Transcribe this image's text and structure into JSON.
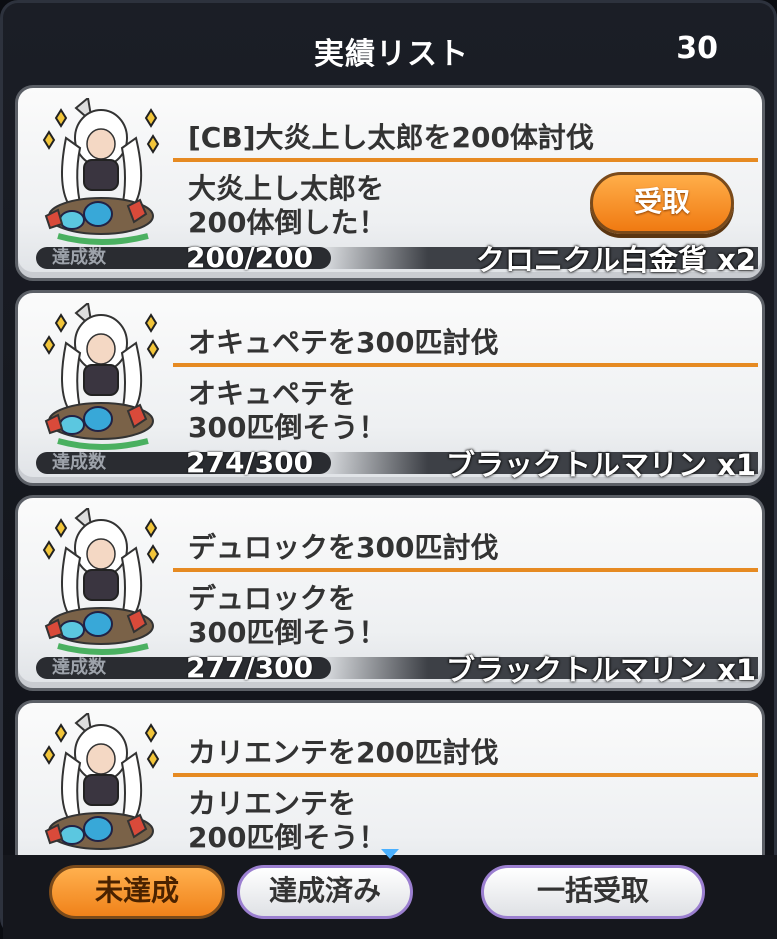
{
  "header": {
    "title": "実績リスト",
    "count": "30"
  },
  "achievements": [
    {
      "title": "[CB]大炎上し太郎を200体討伐",
      "desc_line1": "大炎上し太郎を",
      "desc_line2": "200体倒した！",
      "progress_label": "達成数",
      "progress": "200/200",
      "reward": "クロニクル白金貨 x2",
      "claim_label": "受取",
      "claimable": true
    },
    {
      "title": "オキュペテを300匹討伐",
      "desc_line1": "オキュペテを",
      "desc_line2": "300匹倒そう！",
      "progress_label": "達成数",
      "progress": "274/300",
      "reward": "ブラックトルマリン x1",
      "claimable": false
    },
    {
      "title": "デュロックを300匹討伐",
      "desc_line1": "デュロックを",
      "desc_line2": "300匹倒そう！",
      "progress_label": "達成数",
      "progress": "277/300",
      "reward": "ブラックトルマリン x1",
      "claimable": false
    },
    {
      "title": "カリエンテを200匹討伐",
      "desc_line1": "カリエンテを",
      "desc_line2": "200匹倒そう！",
      "claimable": false
    }
  ],
  "footer": {
    "tab_incomplete": "未達成",
    "tab_complete": "達成済み",
    "bulk_claim": "一括受取"
  },
  "colors": {
    "accent": "#f08a1e",
    "tab_border": "#9b7fd0",
    "scroll_arrow": "#4ab0ff"
  }
}
